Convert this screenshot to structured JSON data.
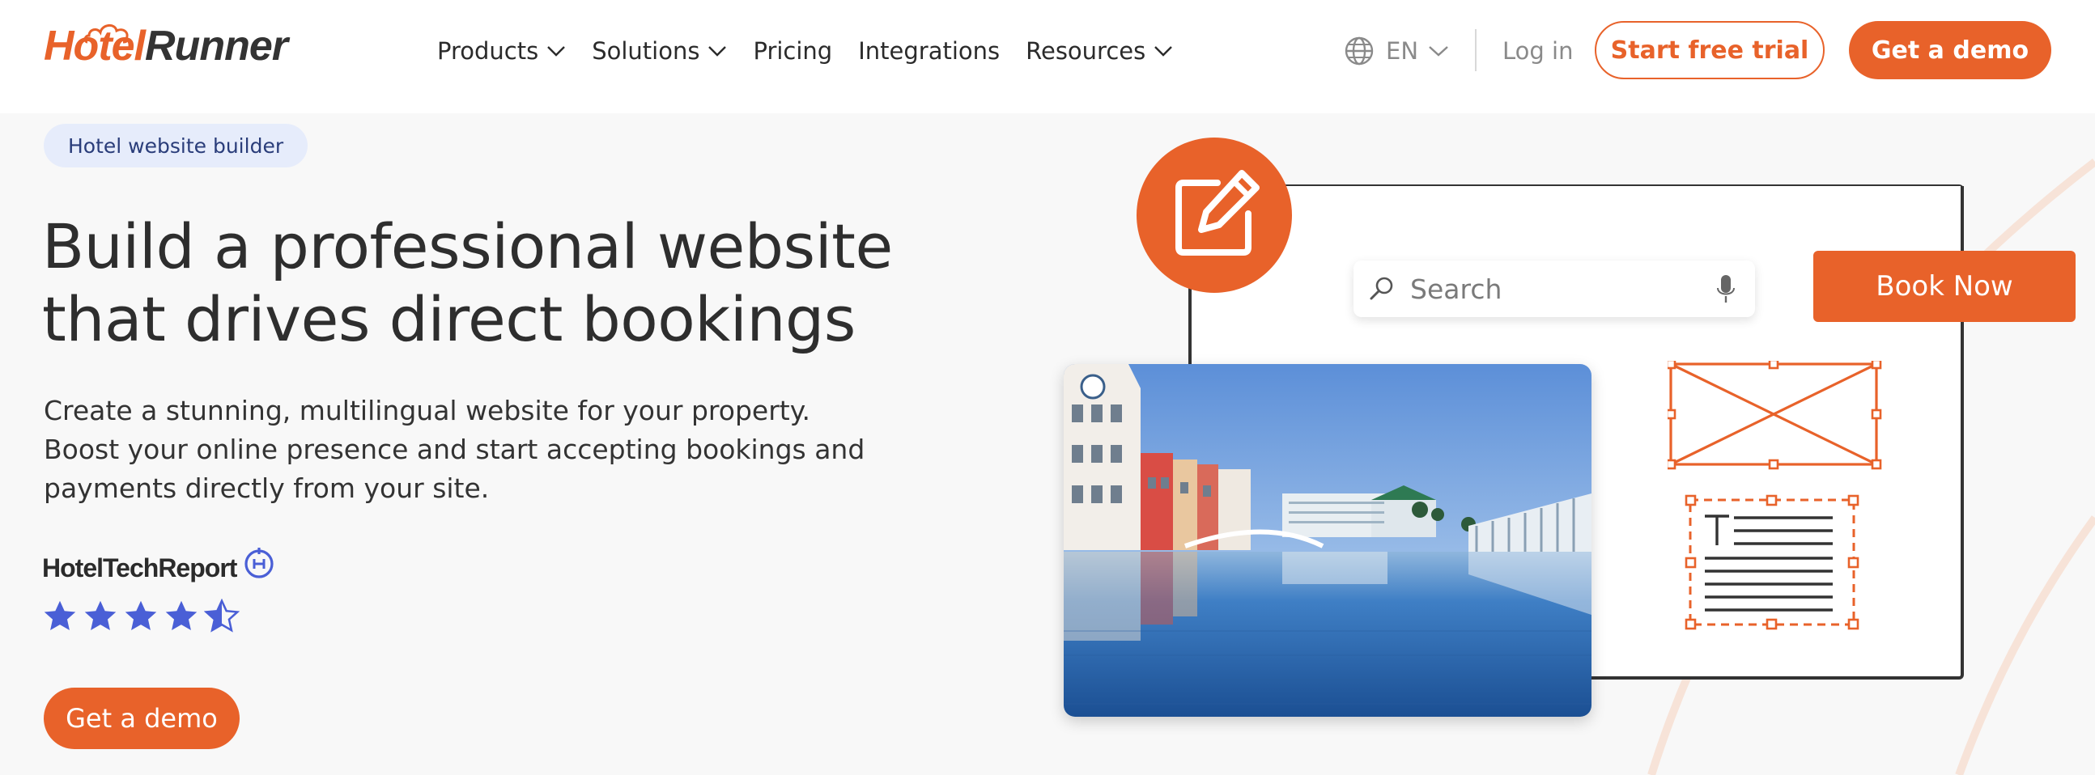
{
  "header": {
    "logo": {
      "part1": "Hotel",
      "part2": "Runner"
    },
    "nav": [
      {
        "label": "Products",
        "has_dropdown": true
      },
      {
        "label": "Solutions",
        "has_dropdown": true
      },
      {
        "label": "Pricing",
        "has_dropdown": false
      },
      {
        "label": "Integrations",
        "has_dropdown": false
      },
      {
        "label": "Resources",
        "has_dropdown": true
      }
    ],
    "language": "EN",
    "login": "Log in",
    "start_trial": "Start free trial",
    "get_demo": "Get a demo"
  },
  "hero": {
    "tag": "Hotel website builder",
    "headline_line1": "Build a professional website",
    "headline_line2": "that drives direct bookings",
    "description": "Create a stunning, multilingual website for your property. Boost your online presence and start accepting bookings and payments directly from your site.",
    "review_brand": "HotelTechReport",
    "rating": {
      "value": 4.5,
      "max": 5
    },
    "cta": "Get a demo"
  },
  "illustration": {
    "search_placeholder": "Search",
    "book_now": "Book Now"
  },
  "colors": {
    "brand_orange": "#e8622a",
    "star_blue": "#4a5fd6",
    "tag_bg": "#e6ecfb",
    "dark": "#333333"
  },
  "icons": [
    "chevron-down-icon",
    "globe-icon",
    "edit-icon",
    "search-icon",
    "microphone-icon",
    "star-icon",
    "half-star-icon",
    "image-placeholder-icon",
    "text-placeholder-icon"
  ]
}
